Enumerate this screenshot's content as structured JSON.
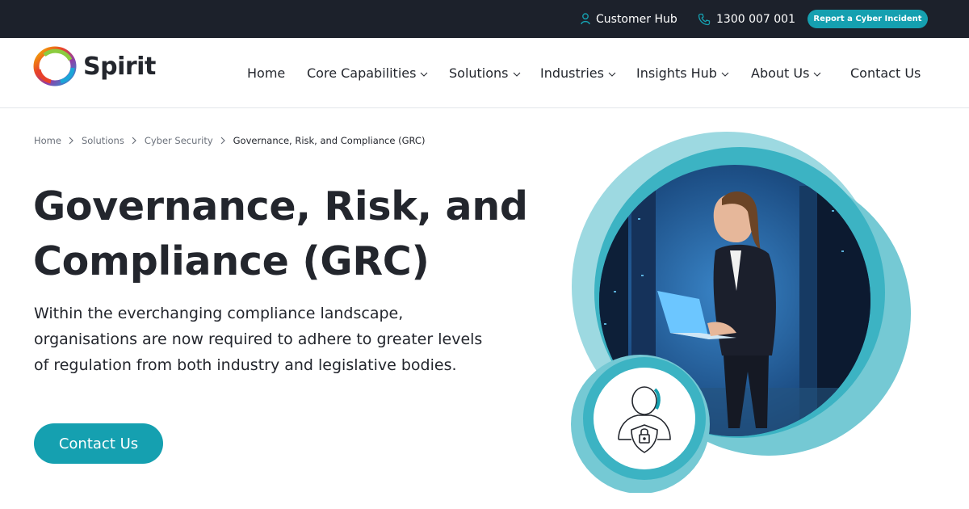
{
  "topbar": {
    "customer_hub": "Customer Hub",
    "phone": "1300 007 001",
    "report_incident": "Report a Cyber Incident"
  },
  "brand": {
    "name": "Spirit"
  },
  "nav": {
    "home": "Home",
    "core_capabilities": "Core Capabilities",
    "solutions": "Solutions",
    "industries": "Industries",
    "insights_hub": "Insights Hub",
    "about_us": "About Us",
    "contact_us": "Contact Us"
  },
  "breadcrumb": {
    "home": "Home",
    "solutions": "Solutions",
    "cyber_security": "Cyber Security",
    "current": "Governance, Risk, and Compliance (GRC)"
  },
  "hero": {
    "title_line1": "Governance, Risk, and",
    "title_line2": "Compliance (GRC)",
    "description": "Within the everchanging compliance landscape, organisations are now required to adhere to greater levels of regulation from both industry and legislative bodies.",
    "cta": "Contact Us"
  },
  "icons": [
    "user-icon",
    "phone-icon",
    "chevron-down-icon",
    "chevron-right-icon",
    "user-shield-lock-icon"
  ],
  "colors": {
    "accent": "#15a0b0",
    "topbar_bg": "#1c212b",
    "text": "#23262d"
  }
}
